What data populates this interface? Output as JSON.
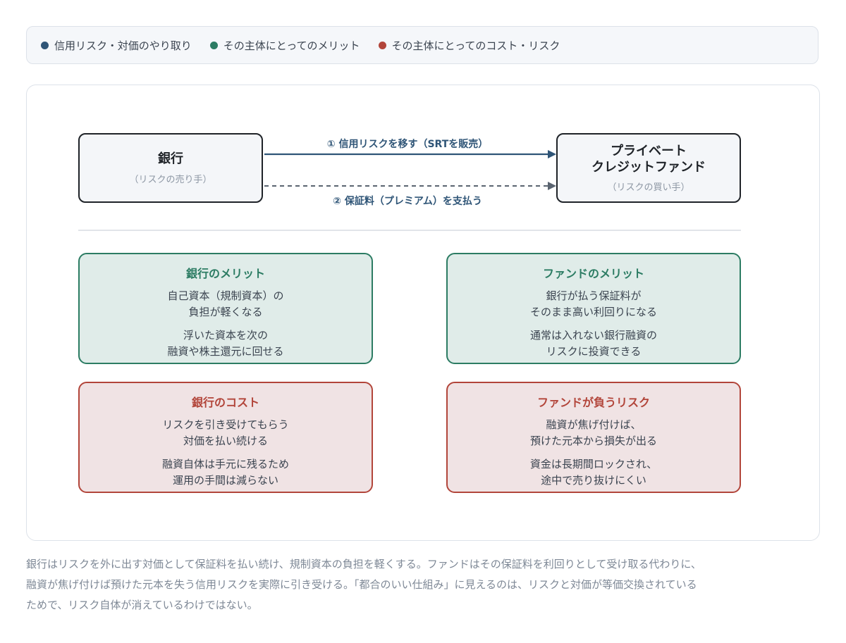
{
  "legend": {
    "items": [
      {
        "label": "信用リスク・対価のやり取り",
        "color": "#2f5577"
      },
      {
        "label": "その主体にとってのメリット",
        "color": "#2c7c63"
      },
      {
        "label": "その主体にとってのコスト・リスク",
        "color": "#b2453a"
      }
    ]
  },
  "diagram": {
    "bank": {
      "title": "銀行",
      "subtitle": "（リスクの売り手）"
    },
    "fund": {
      "title": "プライベート\nクレジットファンド",
      "subtitle": "（リスクの買い手）"
    },
    "edge1": {
      "label": "① 信用リスクを移す（SRTを販売）",
      "style": "solid",
      "color": "#2f5577"
    },
    "edge2": {
      "label": "② 保証料（プレミアム）を支払う",
      "style": "dashed",
      "color": "#5a6470"
    }
  },
  "cards": {
    "bank_merit": {
      "title": "銀行のメリット",
      "lines": [
        "自己資本（規制資本）の\n負担が軽くなる",
        "浮いた資本を次の\n融資や株主還元に回せる"
      ]
    },
    "fund_merit": {
      "title": "ファンドのメリット",
      "lines": [
        "銀行が払う保証料が\nそのまま高い利回りになる",
        "通常は入れない銀行融資の\nリスクに投資できる"
      ]
    },
    "bank_cost": {
      "title": "銀行のコスト",
      "lines": [
        "リスクを引き受けてもらう\n対価を払い続ける",
        "融資自体は手元に残るため\n運用の手間は減らない"
      ]
    },
    "fund_risk": {
      "title": "ファンドが負うリスク",
      "lines": [
        "融資が焦げ付けば、\n預けた元本から損失が出る",
        "資金は長期間ロックされ、\n途中で売り抜けにくい"
      ]
    }
  },
  "caption": "銀行はリスクを外に出す対価として保証料を払い続け、規制資本の負担を軽くする。ファンドはその保証料を利回りとして受け取る代わりに、融資が焦げ付けば預けた元本を失う信用リスクを実際に引き受ける。「都合のいい仕組み」に見えるのは、リスクと対価が等価交換されているためで、リスク自体が消えているわけではない。"
}
